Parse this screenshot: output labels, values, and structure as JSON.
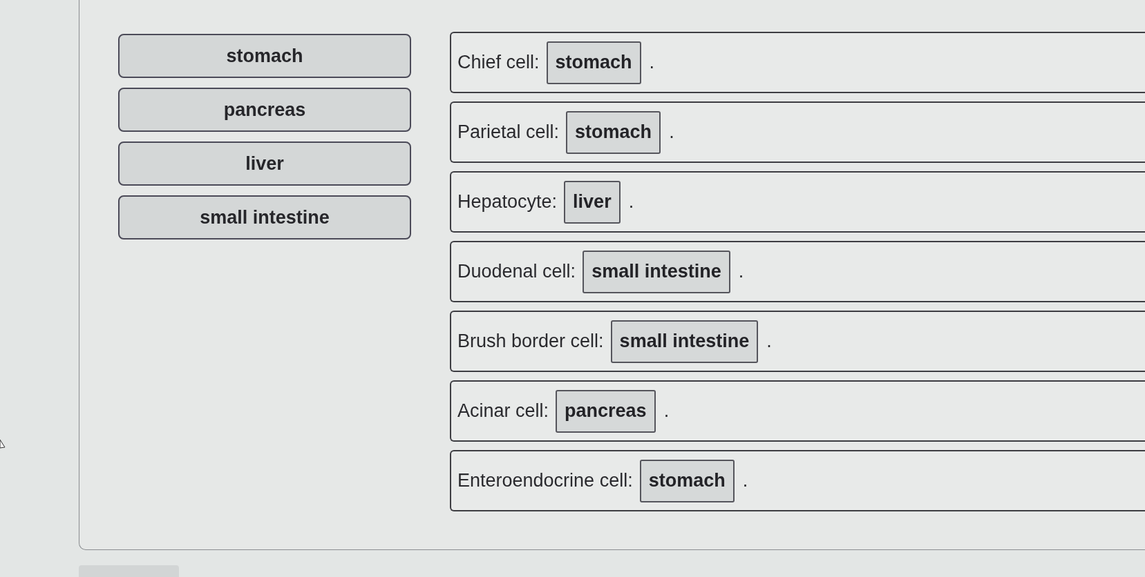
{
  "answer_bank": {
    "tiles": [
      {
        "label": "stomach"
      },
      {
        "label": "pancreas"
      },
      {
        "label": "liver"
      },
      {
        "label": "small intestine"
      }
    ]
  },
  "statements": [
    {
      "label": "Chief cell:",
      "answer": "stomach",
      "end": "."
    },
    {
      "label": "Parietal cell:",
      "answer": "stomach",
      "end": "."
    },
    {
      "label": "Hepatocyte:",
      "answer": "liver",
      "end": "."
    },
    {
      "label": "Duodenal cell:",
      "answer": "small intestine",
      "end": "."
    },
    {
      "label": "Brush border cell:",
      "answer": "small intestine",
      "end": "."
    },
    {
      "label": "Acinar cell:",
      "answer": "pancreas",
      "end": "."
    },
    {
      "label": "Enteroendocrine cell:",
      "answer": "stomach",
      "end": "."
    }
  ]
}
